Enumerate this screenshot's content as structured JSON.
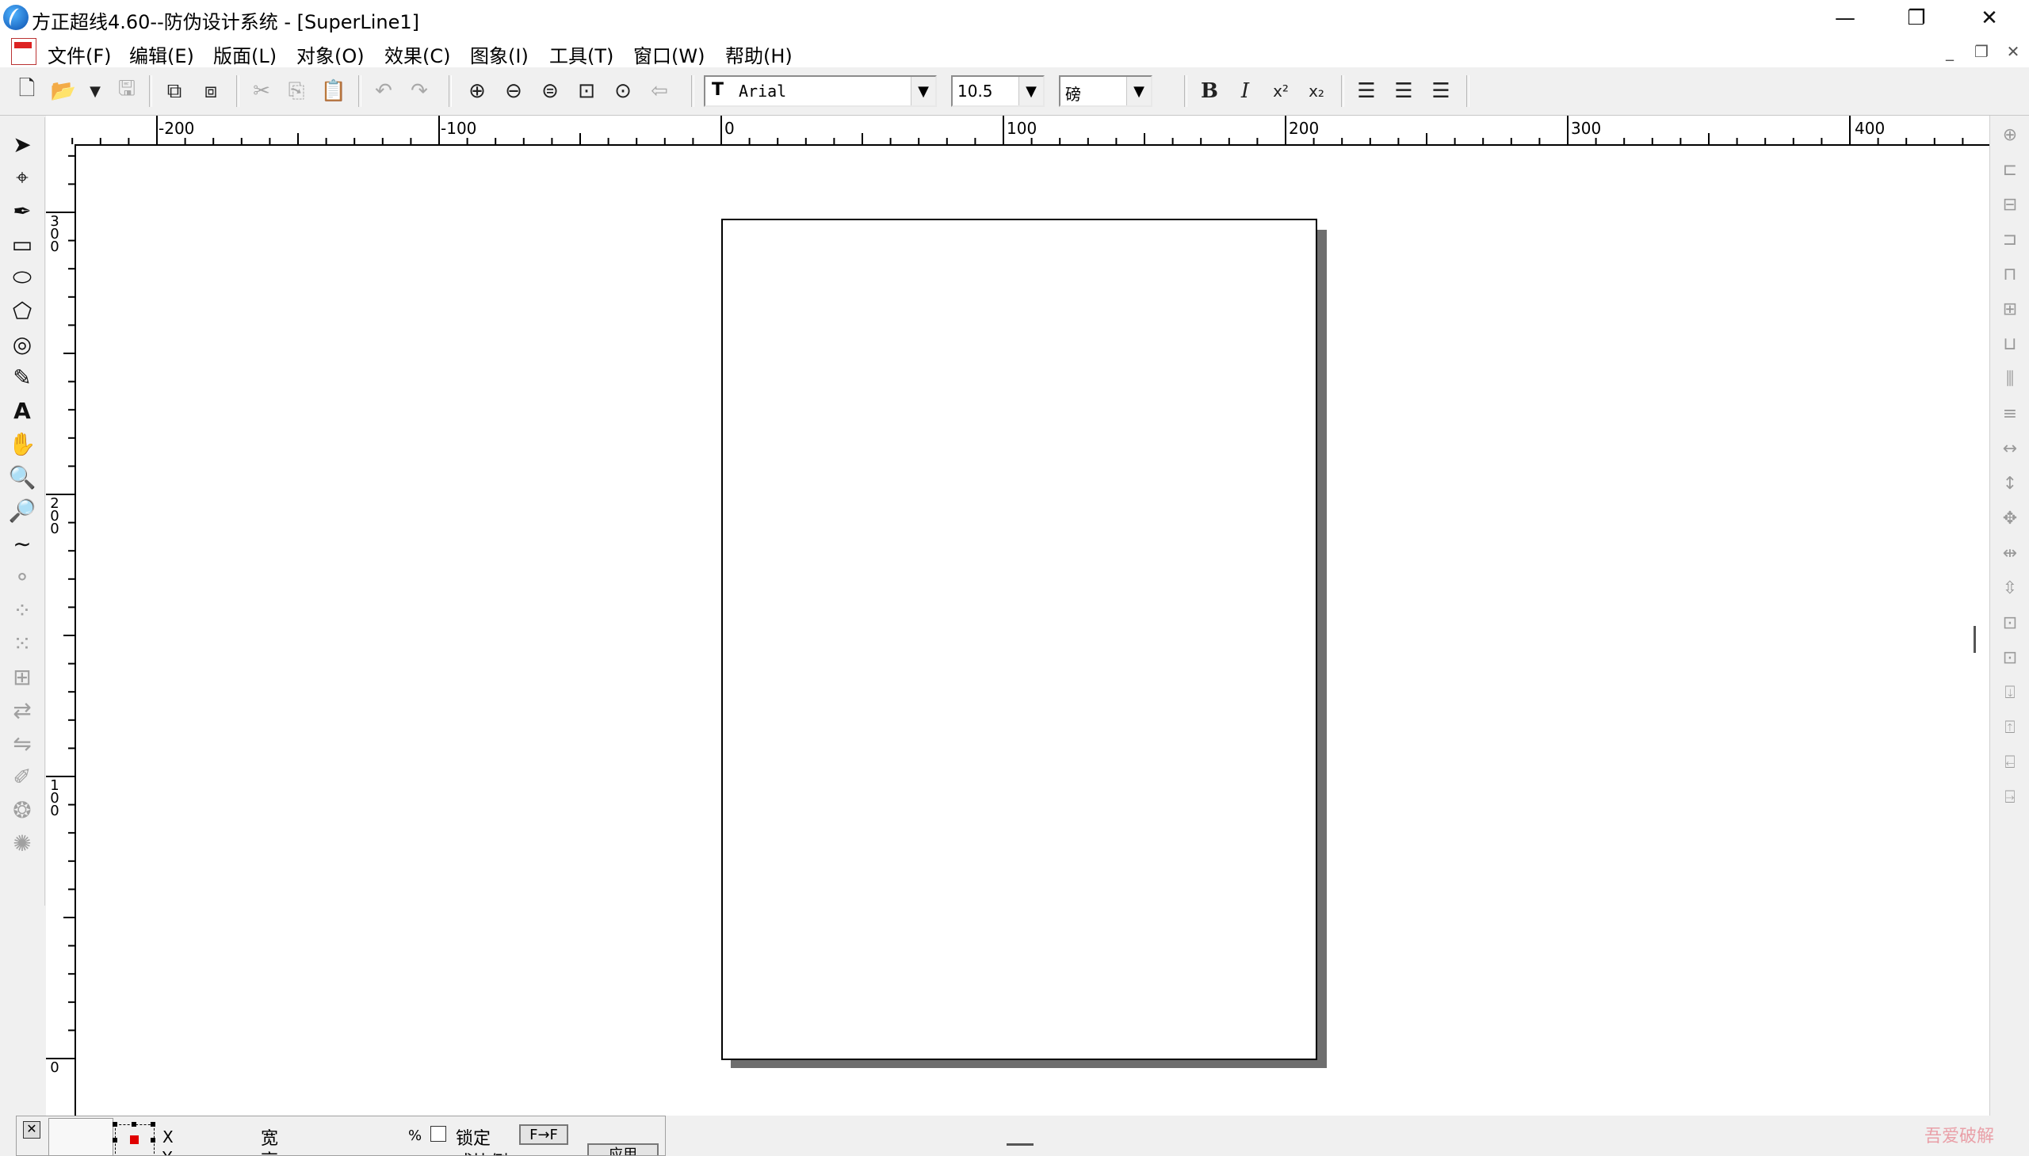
{
  "window": {
    "title": "方正超线4.60--防伪设计系统 - [SuperLine1]",
    "controls": {
      "minimize": "—",
      "restore": "❐",
      "close": "✕"
    }
  },
  "menu": {
    "items": [
      "文件(F)",
      "编辑(E)",
      "版面(L)",
      "对象(O)",
      "效果(C)",
      "图象(I)",
      "工具(T)",
      "窗口(W)",
      "帮助(H)"
    ],
    "mdi_controls": {
      "minimize": "_",
      "restore": "❐",
      "close": "✕"
    }
  },
  "toolbar": {
    "font_name": "Arial",
    "font_size": "10.5",
    "font_unit": "磅",
    "bold": "B",
    "italic": "I",
    "superscript": "x²",
    "subscript": "x₂"
  },
  "ruler": {
    "h_labels": [
      "-200",
      "-100",
      "0",
      "100",
      "200",
      "300",
      "400"
    ],
    "v_labels": [
      "300",
      "200",
      "100",
      "0"
    ]
  },
  "props": {
    "x_label": "X",
    "y_label": "Y",
    "width_label": "宽",
    "height_label": "高",
    "percent": "%",
    "lock_label": "锁定",
    "ratio_label": "成比例",
    "f_button": "F→F",
    "apply_label": "应用"
  },
  "colors": {
    "page_shadow": "#6e6e6e",
    "anchor_red": "#e00000"
  },
  "watermark": "吾爱破解"
}
